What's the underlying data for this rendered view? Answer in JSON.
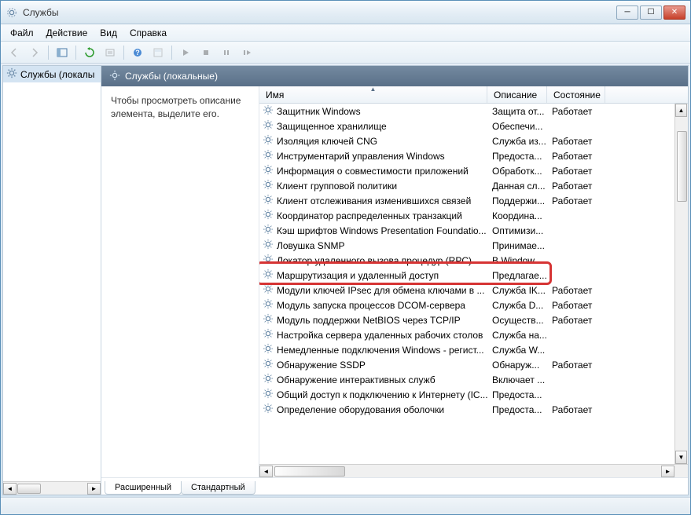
{
  "title": "Службы",
  "menu": {
    "file": "Файл",
    "action": "Действие",
    "view": "Вид",
    "help": "Справка"
  },
  "tree": {
    "root": "Службы (локалы"
  },
  "detail_header": "Службы (локальные)",
  "description": "Чтобы просмотреть описание элемента, выделите его.",
  "columns": {
    "name": "Имя",
    "desc": "Описание",
    "state": "Состояние"
  },
  "tabs": {
    "extended": "Расширенный",
    "standard": "Стандартный"
  },
  "services": [
    {
      "name": "Защитник Windows",
      "desc": "Защита от...",
      "state": "Работает"
    },
    {
      "name": "Защищенное хранилище",
      "desc": "Обеспечи...",
      "state": ""
    },
    {
      "name": "Изоляция ключей CNG",
      "desc": "Служба из...",
      "state": "Работает"
    },
    {
      "name": "Инструментарий управления Windows",
      "desc": "Предоста...",
      "state": "Работает"
    },
    {
      "name": "Информация о совместимости приложений",
      "desc": "Обработк...",
      "state": "Работает"
    },
    {
      "name": "Клиент групповой политики",
      "desc": "Данная сл...",
      "state": "Работает"
    },
    {
      "name": "Клиент отслеживания изменившихся связей",
      "desc": "Поддержи...",
      "state": "Работает"
    },
    {
      "name": "Координатор распределенных транзакций",
      "desc": "Координа...",
      "state": ""
    },
    {
      "name": "Кэш шрифтов Windows Presentation Foundatio...",
      "desc": "Оптимизи...",
      "state": ""
    },
    {
      "name": "Ловушка SNMP",
      "desc": "Принимае...",
      "state": ""
    },
    {
      "name": "Локатор удаленного вызова процедур (RPC)",
      "desc": "В Windows...",
      "state": ""
    },
    {
      "name": "Маршрутизация и удаленный доступ",
      "desc": "Предлагае...",
      "state": ""
    },
    {
      "name": "Модули ключей IPsec для обмена ключами в ...",
      "desc": "Служба IK...",
      "state": "Работает"
    },
    {
      "name": "Модуль запуска процессов DCOM-сервера",
      "desc": "Служба D...",
      "state": "Работает"
    },
    {
      "name": "Модуль поддержки NetBIOS через TCP/IP",
      "desc": "Осуществ...",
      "state": "Работает"
    },
    {
      "name": "Настройка сервера удаленных рабочих столов",
      "desc": "Служба на...",
      "state": ""
    },
    {
      "name": "Немедленные подключения Windows - регист...",
      "desc": "Служба W...",
      "state": ""
    },
    {
      "name": "Обнаружение SSDP",
      "desc": "Обнаруж...",
      "state": "Работает"
    },
    {
      "name": "Обнаружение интерактивных служб",
      "desc": "Включает ...",
      "state": ""
    },
    {
      "name": "Общий доступ к подключению к Интернету (IC...",
      "desc": "Предоста...",
      "state": ""
    },
    {
      "name": "Определение оборудования оболочки",
      "desc": "Предоста...",
      "state": "Работает"
    }
  ],
  "highlight_index": 11
}
